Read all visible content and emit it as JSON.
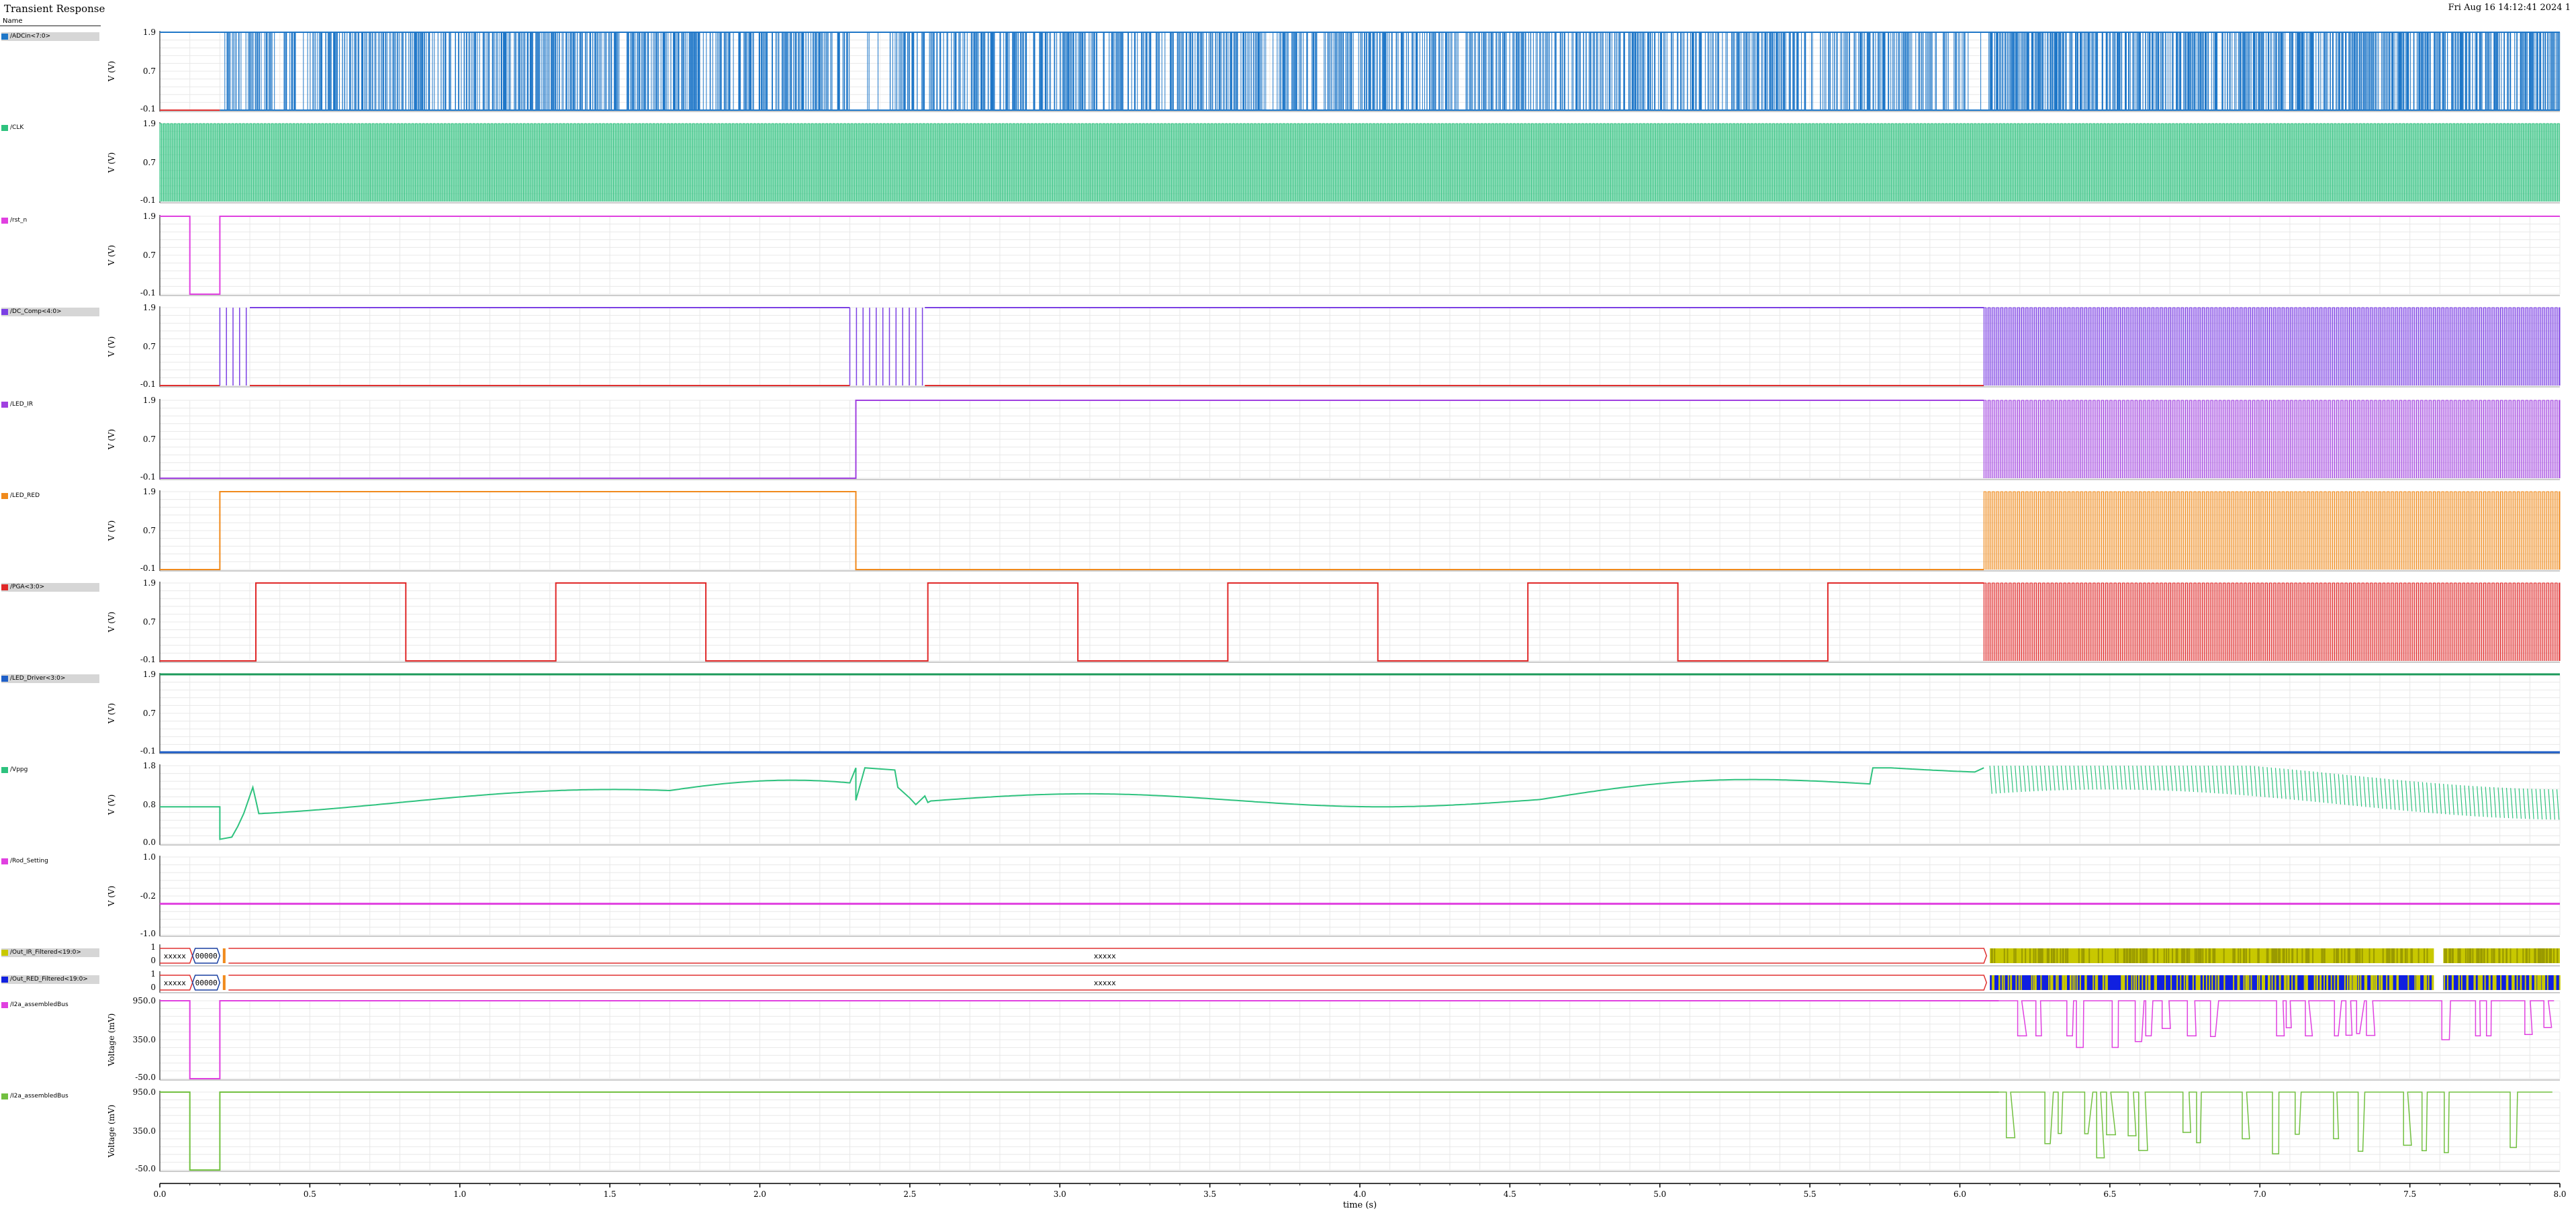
{
  "window": {
    "title": "Transient Response",
    "timestamp": "Fri Aug 16 14:12:41 2024",
    "page_number": "1",
    "name_column": "Name"
  },
  "colors": {
    "grid": "#e8e8e8",
    "axis": "#000000"
  },
  "chart_data": {
    "type": "line",
    "xlabel": "time (s)",
    "xlim": [
      0.0,
      8.0
    ],
    "x_ticks": [
      "0.0",
      "0.5",
      "1.0",
      "1.5",
      "2.0",
      "2.5",
      "3.0",
      "3.5",
      "4.0",
      "4.5",
      "5.0",
      "5.5",
      "6.0",
      "6.5",
      "7.0",
      "7.5",
      "8.0"
    ],
    "panels": [
      {
        "name": "/ADCin<7:0>",
        "bus": true,
        "color": "#1f77c8",
        "ylabel": "V (V)",
        "ticks": [
          "1.9",
          "0.7",
          "-0.1"
        ],
        "kind": "dense_bus",
        "segments": [
          [
            0.2,
            0.35,
            0.55
          ],
          [
            0.35,
            1.1,
            0.7
          ],
          [
            1.1,
            1.3,
            0.85
          ],
          [
            1.3,
            2.3,
            0.75
          ],
          [
            2.3,
            2.45,
            0.1
          ],
          [
            2.45,
            3.0,
            0.7
          ],
          [
            3.0,
            4.0,
            0.65
          ],
          [
            4.0,
            5.0,
            0.7
          ],
          [
            5.0,
            6.0,
            0.65
          ],
          [
            6.0,
            6.1,
            0.2
          ],
          [
            6.1,
            8.0,
            0.95
          ]
        ]
      },
      {
        "name": "/CLK",
        "bus": false,
        "color": "#2ec27e",
        "ylabel": "V (V)",
        "ticks": [
          "1.9",
          "0.7",
          "-0.1"
        ],
        "kind": "clock"
      },
      {
        "name": "/rst_n",
        "bus": false,
        "color": "#e040e0",
        "ylabel": "V (V)",
        "ticks": [
          "1.9",
          "0.7",
          "-0.1"
        ],
        "kind": "step",
        "points": [
          [
            0.0,
            1.9
          ],
          [
            0.1,
            1.9
          ],
          [
            0.1,
            -0.1
          ],
          [
            0.2,
            -0.1
          ],
          [
            0.2,
            1.9
          ],
          [
            8.0,
            1.9
          ]
        ]
      },
      {
        "name": "/DC_Comp<4:0>",
        "bus": true,
        "color": "#7b3fe4",
        "ylabel": "V (V)",
        "ticks": [
          "1.9",
          "0.7",
          "-0.1"
        ],
        "kind": "comp",
        "bursts": [
          [
            0.2,
            0.3
          ],
          [
            2.3,
            2.55
          ]
        ],
        "dense_from": 6.08,
        "baseline_color": "#e03030"
      },
      {
        "name": "/LED_IR",
        "bus": false,
        "color": "#a040e0",
        "ylabel": "V (V)",
        "ticks": [
          "1.9",
          "0.7",
          "-0.1"
        ],
        "kind": "step_dense",
        "points": [
          [
            0.0,
            -0.1
          ],
          [
            2.32,
            -0.1
          ],
          [
            2.32,
            1.9
          ],
          [
            6.08,
            1.9
          ]
        ],
        "dense_from": 6.08
      },
      {
        "name": "/LED_RED",
        "bus": false,
        "color": "#f08a1c",
        "ylabel": "V (V)",
        "ticks": [
          "1.9",
          "0.7",
          "-0.1"
        ],
        "kind": "step_dense",
        "points": [
          [
            0.0,
            -0.1
          ],
          [
            0.2,
            -0.1
          ],
          [
            0.2,
            1.9
          ],
          [
            2.32,
            1.9
          ],
          [
            2.32,
            -0.1
          ],
          [
            6.08,
            -0.1
          ]
        ],
        "dense_from": 6.08
      },
      {
        "name": "/PGA<3:0>",
        "bus": true,
        "color": "#e02828",
        "ylabel": "V (V)",
        "ticks": [
          "1.9",
          "0.7",
          "-0.1"
        ],
        "kind": "step_dense",
        "points": [
          [
            0.0,
            -0.1
          ],
          [
            0.32,
            -0.1
          ],
          [
            0.32,
            1.9
          ],
          [
            0.82,
            1.9
          ],
          [
            0.82,
            -0.1
          ],
          [
            1.32,
            -0.1
          ],
          [
            1.32,
            1.9
          ],
          [
            1.82,
            1.9
          ],
          [
            1.82,
            -0.1
          ],
          [
            2.56,
            -0.1
          ],
          [
            2.56,
            1.9
          ],
          [
            3.06,
            1.9
          ],
          [
            3.06,
            -0.1
          ],
          [
            3.56,
            -0.1
          ],
          [
            3.56,
            1.9
          ],
          [
            4.06,
            1.9
          ],
          [
            4.06,
            -0.1
          ],
          [
            4.56,
            -0.1
          ],
          [
            4.56,
            1.9
          ],
          [
            5.06,
            1.9
          ],
          [
            5.06,
            -0.1
          ],
          [
            5.56,
            -0.1
          ],
          [
            5.56,
            1.9
          ],
          [
            6.08,
            1.9
          ]
        ],
        "dense_from": 6.08
      },
      {
        "name": "/LED_Driver<3:0>",
        "bus": true,
        "color": "#1f5fc8",
        "ylabel": "V (V)",
        "ticks": [
          "1.9",
          "0.7",
          "-0.1"
        ],
        "kind": "flat_pair",
        "levels": [
          [
            1.9,
            "#1c9a5a"
          ],
          [
            -0.1,
            "#1f5fc8"
          ]
        ]
      },
      {
        "name": "/Vppg",
        "bus": false,
        "color": "#2ec27e",
        "ylabel": "V (V)",
        "ticks": [
          "1.8",
          "0.8",
          "0.0"
        ],
        "ymin": 0.0,
        "ymax": 1.8,
        "kind": "analog"
      },
      {
        "name": "/Rod_Setting",
        "bus": false,
        "color": "#e040e0",
        "ylabel": "V (V)",
        "ticks": [
          "1.0",
          "-0.2",
          "-1.0"
        ],
        "ymin": -1.0,
        "ymax": 1.0,
        "kind": "flat",
        "level": -0.2
      },
      {
        "name": "/Out_IR_Filtered<19:0>",
        "bus": true,
        "color": "#c8c800",
        "ylabel": "",
        "ticks": [
          "1",
          "0"
        ],
        "kind": "digital_bus",
        "values": [
          "xxxxx",
          "00000",
          "xxxxx"
        ],
        "accent": "#9a9a00"
      },
      {
        "name": "/Out_RED_Filtered<19:0>",
        "bus": true,
        "color": "#1020e0",
        "ylabel": "",
        "ticks": [
          "1",
          "0"
        ],
        "kind": "digital_bus",
        "values": [
          "xxxxx",
          "00000",
          "xxxxx"
        ],
        "accent": "#c8c800"
      },
      {
        "name": "/I2a_assembledBus",
        "bus": false,
        "color": "#e040e0",
        "ylabel": "Voltage (mV)",
        "ticks": [
          "950.0",
          "350.0",
          "-50.0"
        ],
        "ymin": -50,
        "ymax": 950,
        "kind": "glitchy"
      },
      {
        "name": "/I2a_assembledBus",
        "bus": false,
        "color": "#72c040",
        "ylabel": "Voltage (mV)",
        "ticks": [
          "950.0",
          "350.0",
          "-50.0"
        ],
        "ymin": -50,
        "ymax": 950,
        "kind": "glitchy2"
      }
    ]
  }
}
